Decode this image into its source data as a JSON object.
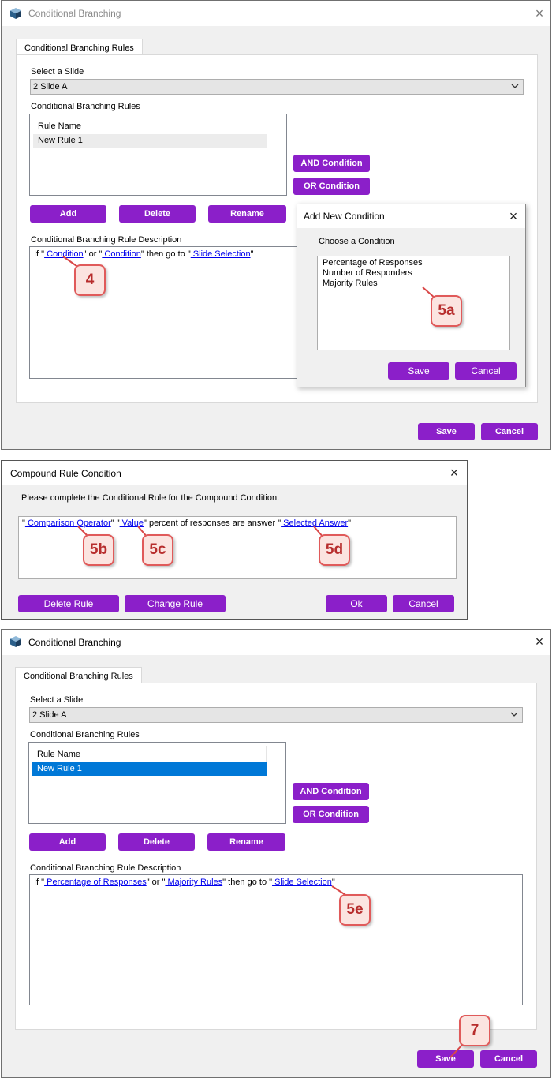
{
  "window1": {
    "title": "Conditional Branching",
    "tab": "Conditional Branching Rules",
    "select_label": "Select a Slide",
    "selected_slide": "2 Slide A",
    "rules_label": "Conditional Branching Rules",
    "column_header": "Rule Name",
    "rules": [
      "New Rule 1"
    ],
    "and_button": "AND Condition",
    "or_button": "OR Condition",
    "add_button": "Add",
    "delete_button": "Delete",
    "rename_button": "Rename",
    "description_label": "Conditional Branching Rule Description",
    "rule_parts": {
      "if_prefix": "If \"",
      "condition1": " Condition",
      "or_text": "\" or \"",
      "condition2": " Condition",
      "then_text": "\"  then go to \"",
      "slide_selection": " Slide Selection",
      "end_quote": "\""
    },
    "save_button": "Save",
    "cancel_button": "Cancel"
  },
  "add_condition_dialog": {
    "title": "Add New Condition",
    "prompt": "Choose a Condition",
    "options": [
      "Percentage of Responses",
      "Number of Responders",
      "Majority Rules"
    ],
    "save_button": "Save",
    "cancel_button": "Cancel"
  },
  "compound_dialog": {
    "title": "Compound Rule Condition",
    "instruction": "Please complete the Conditional Rule for the Compound Condition.",
    "rule_parts": {
      "q1": "\"",
      "comparison_operator": " Comparison Operator",
      "q2": "\" \"",
      "value": " Value",
      "middle_text": "\"  percent of responses are answer \"",
      "selected_answer": " Selected Answer",
      "q3": "\""
    },
    "delete_rule_button": "Delete Rule",
    "change_rule_button": "Change Rule",
    "ok_button": "Ok",
    "cancel_button": "Cancel"
  },
  "window2": {
    "title": "Conditional Branching",
    "tab": "Conditional Branching Rules",
    "select_label": "Select a Slide",
    "selected_slide": "2 Slide A",
    "rules_label": "Conditional Branching Rules",
    "column_header": "Rule Name",
    "rules": [
      "New Rule 1"
    ],
    "and_button": "AND Condition",
    "or_button": "OR Condition",
    "add_button": "Add",
    "delete_button": "Delete",
    "rename_button": "Rename",
    "description_label": "Conditional Branching Rule Description",
    "rule_parts": {
      "if_prefix": "If \"",
      "condition1": " Percentage of Responses",
      "or_text": "\" or \"",
      "condition2": " Majority Rules",
      "then_text": "\"  then go to \"",
      "slide_selection": " Slide Selection",
      "end_quote": "\""
    },
    "save_button": "Save",
    "cancel_button": "Cancel"
  },
  "callouts": {
    "c4": "4",
    "c5a": "5a",
    "c5b": "5b",
    "c5c": "5c",
    "c5d": "5d",
    "c5e": "5e",
    "c7": "7"
  },
  "colors": {
    "button_purple": "#8b1fc9",
    "selection_blue": "#0078d7",
    "link_blue": "#0000ee",
    "callout_border": "#e05a5a",
    "callout_fill": "#fbe4e0"
  }
}
